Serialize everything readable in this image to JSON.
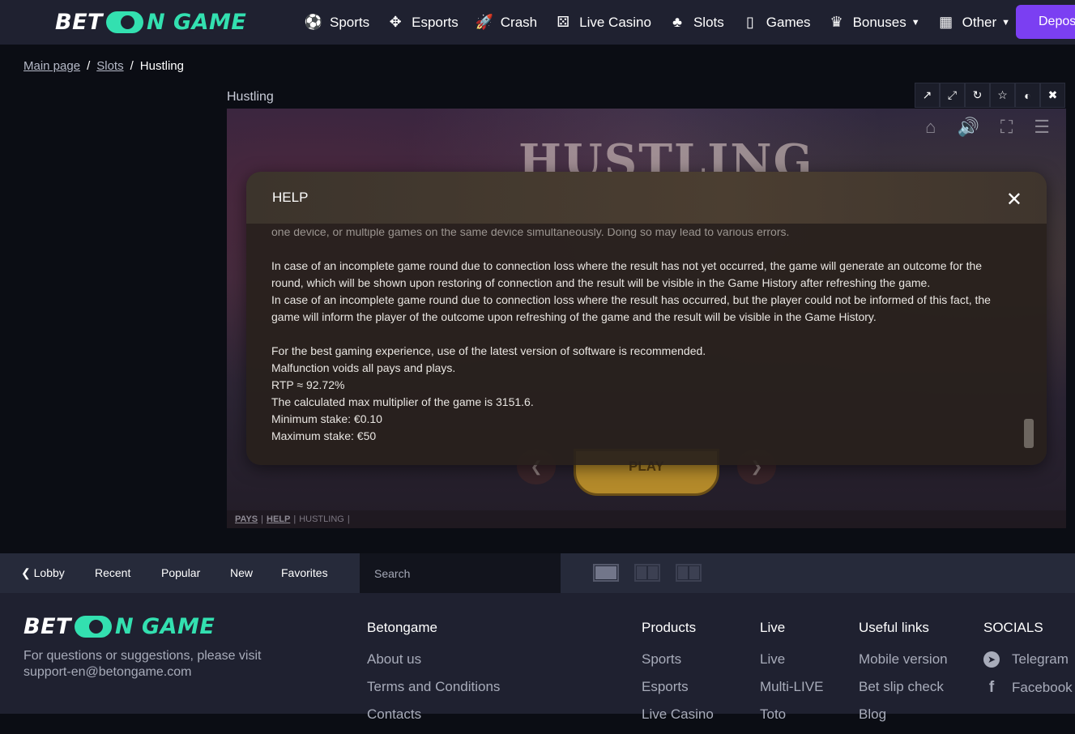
{
  "header": {
    "logo": {
      "left": "BET",
      "right": "N GAME"
    },
    "nav": [
      {
        "label": "Sports",
        "icon": "soccer-ball-icon",
        "glyph": "⚽",
        "dropdown": false
      },
      {
        "label": "Esports",
        "icon": "gamepad-icon",
        "glyph": "✥",
        "dropdown": false
      },
      {
        "label": "Crash",
        "icon": "rocket-icon",
        "glyph": "🚀",
        "dropdown": false
      },
      {
        "label": "Live Casino",
        "icon": "dice-icon",
        "glyph": "⚄",
        "dropdown": false
      },
      {
        "label": "Slots",
        "icon": "cherries-icon",
        "glyph": "♣",
        "dropdown": false
      },
      {
        "label": "Games",
        "icon": "cards-icon",
        "glyph": "▯",
        "dropdown": false
      },
      {
        "label": "Bonuses",
        "icon": "crown-icon",
        "glyph": "♛",
        "dropdown": true
      },
      {
        "label": "Other",
        "icon": "grid-icon",
        "glyph": "▦",
        "dropdown": true
      }
    ],
    "deposit_label": "Depos"
  },
  "breadcrumb": {
    "items": [
      "Main page",
      "Slots"
    ],
    "current": "Hustling",
    "separator": "/"
  },
  "game": {
    "title": "Hustling",
    "toolbar": [
      "external-link-icon",
      "expand-icon",
      "reload-icon",
      "star-icon",
      "toggle-icon",
      "close-icon"
    ],
    "logo_text": "HUSTLING",
    "play_label": "PLAY",
    "footer": {
      "pays": "PAYS",
      "help": "HELP",
      "name": "HUSTLING"
    }
  },
  "help": {
    "title": "HELP",
    "cut_line": "one device, or multiple games on the same device simultaneously. Doing so may lead to various errors.",
    "para1a": "In case of an incomplete game round due to connection loss where the result has not yet occurred, the game will generate an outcome for the",
    "para1b": "round, which will be shown upon restoring of connection and the result will be visible in the Game History after refreshing the game.",
    "para2a": "In case of an incomplete game round due to connection loss where the result has occurred, but the player could not be informed of this fact, the",
    "para2b": "game will inform the player of the outcome upon refreshing of the game and the result will be visible in the Game History.",
    "line1": "For the best gaming experience, use of the latest version of software is recommended.",
    "line2": "Malfunction voids all pays and plays.",
    "line3": "RTP ≈ 92.72%",
    "line4": "The calculated max multiplier of the game is 3151.6.",
    "line5": "Minimum stake: €0.10",
    "line6": "Maximum stake: €50"
  },
  "gamebar": {
    "lobby": "Lobby",
    "tabs": [
      "Recent",
      "Popular",
      "New",
      "Favorites"
    ],
    "search_placeholder": "Search"
  },
  "footer": {
    "description_line1": "For questions or suggestions, please visit",
    "description_line2": "support-en@betongame.com",
    "columns": [
      {
        "heading": "Betongame",
        "links": [
          "About us",
          "Terms and Conditions",
          "Contacts"
        ]
      },
      {
        "heading": "Products",
        "links": [
          "Sports",
          "Esports",
          "Live Casino"
        ]
      },
      {
        "heading": "Live",
        "links": [
          "Live",
          "Multi-LIVE",
          "Toto"
        ]
      },
      {
        "heading": "Useful links",
        "links": [
          "Mobile version",
          "Bet slip check",
          "Blog"
        ]
      },
      {
        "heading": "SOCIALS",
        "links": [
          "Telegram",
          "Facebook"
        ]
      }
    ]
  }
}
